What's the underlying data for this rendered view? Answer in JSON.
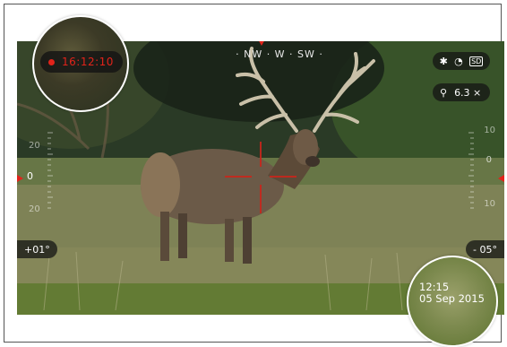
{
  "compass": {
    "heading_text": "· NW · W · SW ·"
  },
  "status": {
    "bluetooth_icon": "bluetooth-icon",
    "wifi_icon": "wifi-icon",
    "sd_icon": "sd-card-icon",
    "sd_label": "SD"
  },
  "zoom": {
    "icon": "magnifier-icon",
    "value": "6.3 ×"
  },
  "left_scale": {
    "upper": "20",
    "center": "0",
    "lower": "20"
  },
  "right_scale": {
    "upper": "10",
    "center": "0",
    "lower": "10"
  },
  "left_angle": "+01°",
  "right_angle": "- 05°",
  "recording": {
    "time": "16:12:10"
  },
  "datetime": {
    "time": "12:15",
    "date": "05 Sep 2015"
  },
  "colors": {
    "accent_red": "#e2231a",
    "hud_pill_bg": "#141414"
  }
}
